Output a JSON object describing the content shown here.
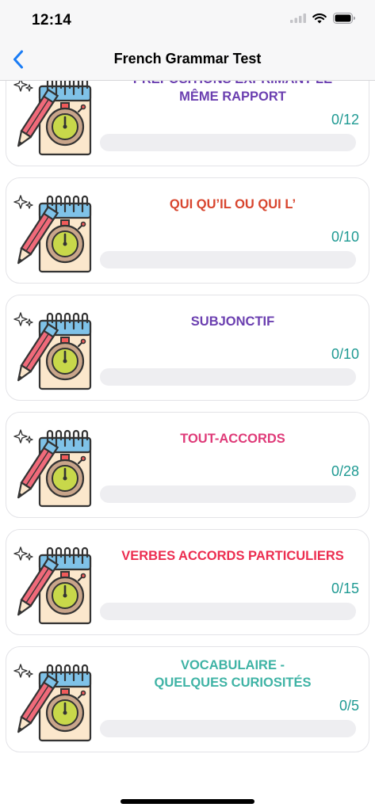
{
  "status_bar": {
    "time": "12:14",
    "signal_icon": "cellular-signal-icon",
    "wifi_icon": "wifi-icon",
    "battery_icon": "battery-icon"
  },
  "nav": {
    "title": "French Grammar Test",
    "back_icon": "chevron-left-icon",
    "accent_color": "#1a7cf5"
  },
  "colors": {
    "count_color": "#1f9a93",
    "track_color": "#eeeef1"
  },
  "quizzes": [
    {
      "title": "PRÉPOSITIONS EXPRIMANT LE\nMÊME RAPPORT",
      "color": "#6b3fb0",
      "count": "0/12",
      "progress": 0,
      "icon": "notebook-timer-icon"
    },
    {
      "title": "QUI QU’IL OU QUI L’",
      "color": "#d8452e",
      "count": "0/10",
      "progress": 0,
      "icon": "notebook-timer-icon"
    },
    {
      "title": "SUBJONCTIF",
      "color": "#6b3fb0",
      "count": "0/10",
      "progress": 0,
      "icon": "notebook-timer-icon"
    },
    {
      "title": "TOUT-ACCORDS",
      "color": "#df3a78",
      "count": "0/28",
      "progress": 0,
      "icon": "notebook-timer-icon"
    },
    {
      "title": "VERBES ACCORDS PARTICULIERS",
      "color": "#ec2d50",
      "count": "0/15",
      "progress": 0,
      "icon": "notebook-timer-icon"
    },
    {
      "title": "VOCABULAIRE -\nQUELQUES CURIOSITÉS",
      "color": "#3fb3a5",
      "count": "0/5",
      "progress": 0,
      "icon": "notebook-timer-icon"
    }
  ]
}
